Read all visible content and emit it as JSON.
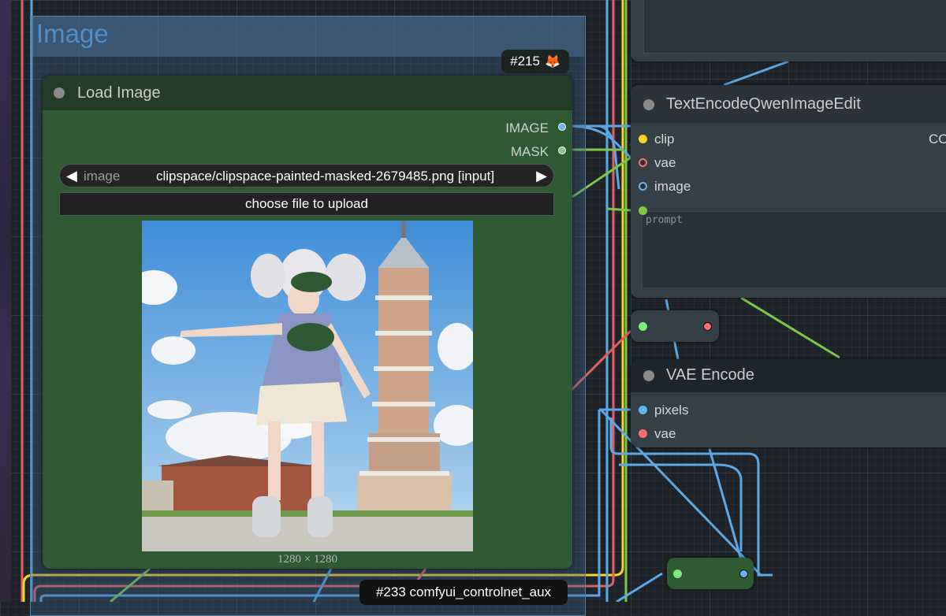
{
  "group": {
    "title": "Image"
  },
  "badge": {
    "id": "#215",
    "icon": "fox-icon"
  },
  "load_image": {
    "title": "Load Image",
    "outputs": [
      {
        "label": "IMAGE",
        "color": "#64b5f6"
      },
      {
        "label": "MASK",
        "color": "#81c784"
      }
    ],
    "widget": {
      "label": "image",
      "value": "clipspace/clipspace-painted-masked-2679485.png [input]"
    },
    "upload_label": "choose file to upload",
    "dimensions": "1280 × 1280"
  },
  "text_encode": {
    "title": "TextEncodeQwenImageEdit",
    "inputs": [
      {
        "label": "clip",
        "color": "#f5d327"
      },
      {
        "label": "vae",
        "color": "#ff6e6e"
      },
      {
        "label": "image",
        "color": "#64b5f6"
      }
    ],
    "output_partial": "CO",
    "prompt_placeholder": "prompt"
  },
  "vae_encode": {
    "title": "VAE Encode",
    "inputs": [
      {
        "label": "pixels",
        "color": "#64b5f6"
      },
      {
        "label": "vae",
        "color": "#ff6e6e"
      }
    ]
  },
  "bottom_badge": {
    "label": "#233 comfyui_controlnet_aux"
  },
  "colors": {
    "image_wire": "#5aa9e6",
    "vae_wire": "#e06060",
    "mask_wire": "#7cc94a",
    "clip_wire": "#f5d327",
    "load_node_body": "#2e5a33",
    "group_title": "#4f90c8"
  }
}
